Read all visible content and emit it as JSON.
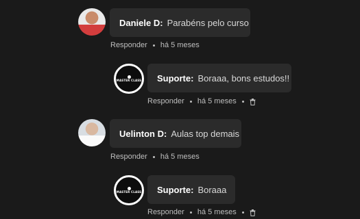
{
  "comments": [
    {
      "author": "Daniele D:",
      "text": "Parabéns pelo curso",
      "reply_label": "Responder",
      "time": "há 5 meses",
      "avatar_icon": "user-photo"
    },
    {
      "author": "Suporte:",
      "text": "Boraaa, bons estudos!!",
      "reply_label": "Responder",
      "time": "há 5 meses",
      "avatar_icon": "support-logo",
      "logo_text": "MASTER CLASS"
    },
    {
      "author": "Uelinton D:",
      "text": "Aulas top demais",
      "reply_label": "Responder",
      "time": "há 5 meses",
      "avatar_icon": "user-photo"
    },
    {
      "author": "Suporte:",
      "text": "Boraaa",
      "reply_label": "Responder",
      "time": "há 5 meses",
      "avatar_icon": "support-logo",
      "logo_text": "MASTER CLASS"
    }
  ],
  "colors": {
    "background": "#1a1a1a",
    "bubble": "#2b2b2b",
    "meta_text": "#bfbfbf",
    "support_ring": "#ffffff"
  }
}
